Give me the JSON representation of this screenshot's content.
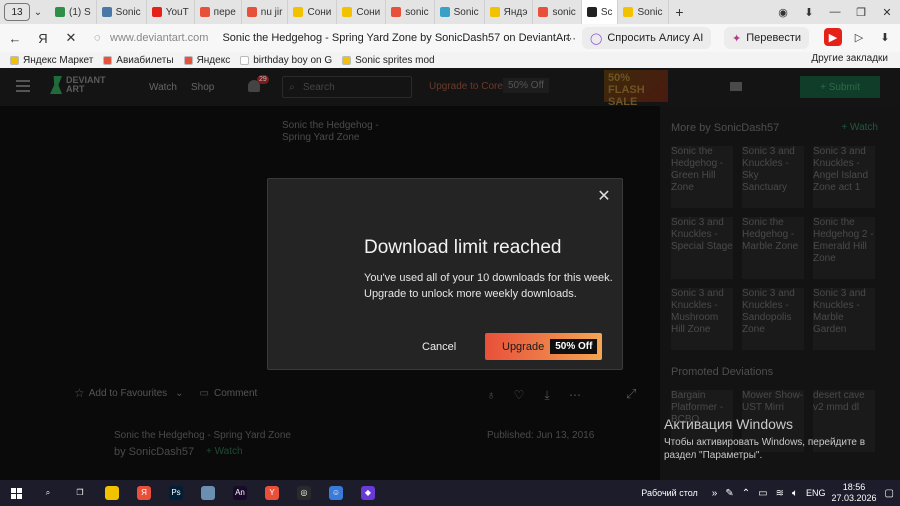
{
  "browser": {
    "tab_count": "13",
    "tabs": [
      {
        "label": "(1) S",
        "color": "#2f8f46"
      },
      {
        "label": "Sonic",
        "color": "#4a76a8"
      },
      {
        "label": "YouT",
        "color": "#e62117"
      },
      {
        "label": "пере",
        "color": "#e8503a"
      },
      {
        "label": "nu jir",
        "color": "#e8503a"
      },
      {
        "label": "Сони",
        "color": "#f2c200"
      },
      {
        "label": "Сони",
        "color": "#f2c200"
      },
      {
        "label": "sonic",
        "color": "#e8503a"
      },
      {
        "label": "Sonic",
        "color": "#3aa0c8"
      },
      {
        "label": "Яндэ",
        "color": "#f2c200"
      },
      {
        "label": "sonic",
        "color": "#e8503a"
      },
      {
        "label": "Sc",
        "color": "#222222",
        "active": true
      },
      {
        "label": "Sonic",
        "color": "#f2c200"
      }
    ],
    "url_host": "www.deviantart.com",
    "page_title": "Sonic the Hedgehog - Spring Yard Zone by SonicDash57 on DeviantArt",
    "alice_label": "Спросить Алису AI",
    "translate_label": "Перевести",
    "bookmarks": [
      {
        "label": "Яндекс Маркет",
        "color": "#f2c200"
      },
      {
        "label": "Авиабилеты",
        "color": "#e8503a"
      },
      {
        "label": "Яндекс",
        "color": "#e8503a"
      },
      {
        "label": "birthday boy on G",
        "color": "#ffffff"
      },
      {
        "label": "Sonic sprites mod",
        "color": "#f2c200"
      }
    ],
    "other_bookmarks": "Другие закладки"
  },
  "deviantart": {
    "logo_line1": "DEVIANT",
    "logo_line2": "ART",
    "watch": "Watch",
    "shop": "Shop",
    "notif_count": "29",
    "search_placeholder": "Search",
    "upgrade_core": "Upgrade to Core",
    "off_badge": "50% Off",
    "promo_text": "50% FLASH SALE",
    "submit": "+ Submit",
    "art_alt": "Sonic the Hedgehog - Spring Yard Zone",
    "more_by": "More by SonicDash57",
    "sidebar_watch": "+ Watch",
    "more_thumbs": [
      "Sonic the Hedgehog - Green Hill Zone",
      "Sonic 3 and Knuckles - Sky Sanctuary",
      "Sonic 3 and Knuckles - Angel Island Zone act 1",
      "Sonic 3 and Knuckles - Special Stage",
      "Sonic the Hedgehog - Marble Zone",
      "Sonic the Hedgehog 2 - Emerald Hill Zone",
      "Sonic 3 and Knuckles - Mushroom Hill Zone",
      "Sonic 3 and Knuckles - Sandopolis Zone",
      "Sonic 3 and Knuckles - Marble Garden"
    ],
    "promoted_label": "Promoted Deviations",
    "promoted_thumbs": [
      "Bargain Platformer - BCBO",
      "Mower Show-UST Mirri",
      "desert cave v2 mmd dl"
    ],
    "add_fav": "Add to Favourites",
    "comment": "Comment",
    "desc_title": "Sonic the Hedgehog - Spring Yard Zone",
    "desc_by": "by SonicDash57",
    "desc_watch": "+ Watch",
    "published": "Published: Jun 13, 2016"
  },
  "modal": {
    "title": "Download limit reached",
    "text": "You've used all of your 10 downloads for this week. Upgrade to unlock more weekly downloads.",
    "cancel": "Cancel",
    "upgrade": "Upgrade",
    "upgrade_pill": "50% Off"
  },
  "activation": {
    "title": "Активация Windows",
    "subtitle": "Чтобы активировать Windows, перейдите в раздел \"Параметры\"."
  },
  "taskbar": {
    "apps": [
      {
        "name": "search-icon",
        "label": "⌕",
        "color": "transparent"
      },
      {
        "name": "task-view-icon",
        "label": "❐",
        "color": "transparent"
      },
      {
        "name": "file-explorer-icon",
        "label": "",
        "color": "#f2c200"
      },
      {
        "name": "yandex-icon",
        "label": "Я",
        "color": "#e8503a"
      },
      {
        "name": "photoshop-icon",
        "label": "Ps",
        "color": "#001e36"
      },
      {
        "name": "app-icon",
        "label": "",
        "color": "#6a8fb0"
      },
      {
        "name": "animate-icon",
        "label": "An",
        "color": "#1a0a2a"
      },
      {
        "name": "yandex-browser-icon",
        "label": "Y",
        "color": "#e8503a"
      },
      {
        "name": "obs-icon",
        "label": "◎",
        "color": "#2a2a2a"
      },
      {
        "name": "app2-icon",
        "label": "☺",
        "color": "#3a7ad8"
      },
      {
        "name": "app3-icon",
        "label": "◆",
        "color": "#6a3ad8"
      }
    ],
    "desktop_label": "Рабочий стол",
    "lang": "ENG",
    "time": "18:56",
    "date": "27.03.2026"
  }
}
